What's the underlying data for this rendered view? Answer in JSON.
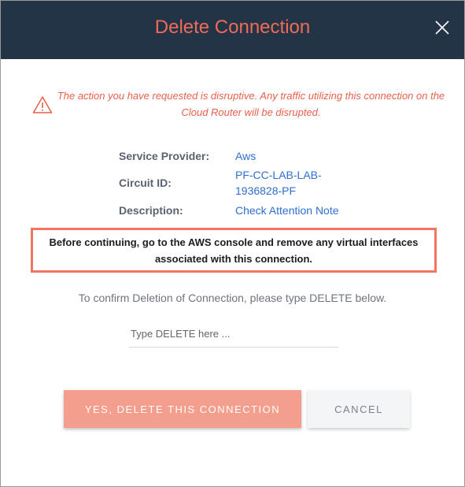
{
  "dialog": {
    "title": "Delete Connection",
    "warning": "The action you have requested is disruptive. Any traffic utilizing this connection on the Cloud Router will be disrupted.",
    "details": {
      "service_provider_label": "Service Provider:",
      "service_provider_value": "Aws",
      "circuit_id_label": "Circuit ID:",
      "circuit_id_value": "PF-CC-LAB-LAB-1936828-PF",
      "description_label": "Description:",
      "description_value": "Check Attention Note"
    },
    "notice": "Before continuing, go to the AWS console and remove any virtual interfaces associated with this connection.",
    "confirm_prompt": "To confirm Deletion of Connection, please type DELETE below.",
    "confirm_input": {
      "placeholder": "Type DELETE here ...",
      "value": ""
    },
    "buttons": {
      "delete_label": "YES, DELETE THIS CONNECTION",
      "cancel_label": "CANCEL"
    },
    "icons": {
      "close": "close-icon",
      "warning": "warning-triangle-icon"
    },
    "colors": {
      "header_bg": "#243447",
      "accent": "#f06b57",
      "link": "#2f6fcf",
      "notice_border": "#f47464",
      "delete_button": "#f49e8e"
    }
  }
}
